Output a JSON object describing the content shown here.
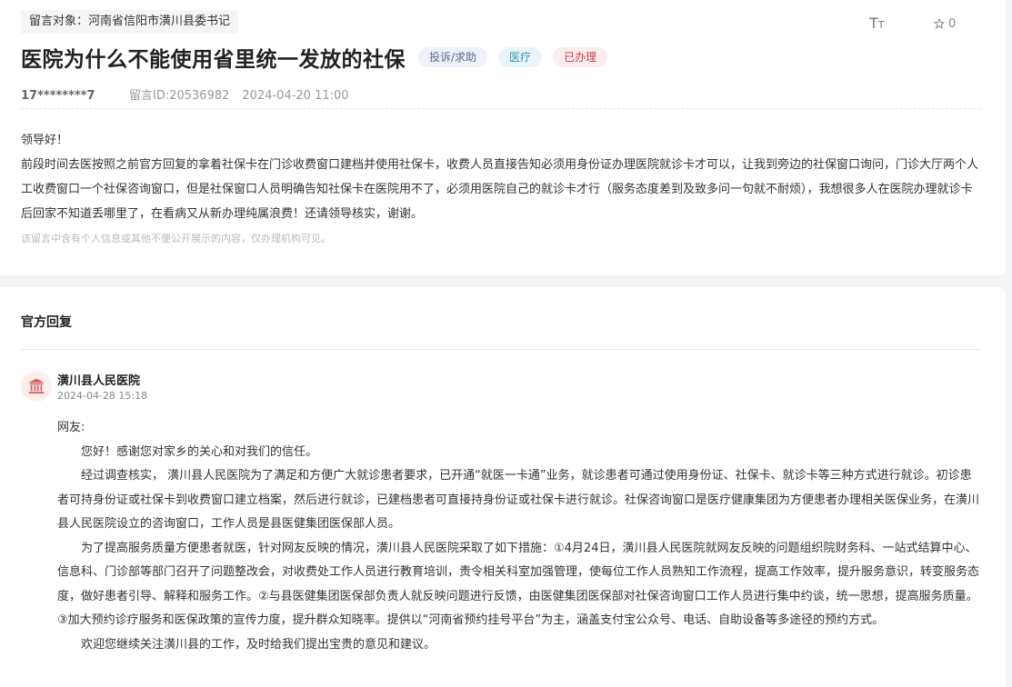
{
  "message": {
    "target_label": "留言对象：河南省信阳市潢川县委书记",
    "font_size_icon": "font-size-icon",
    "star_count": "0",
    "title": "医院为什么不能使用省里统一发放的社保",
    "tags": {
      "type": "投诉/求助",
      "category": "医疗",
      "status": "已办理"
    },
    "user": "17********7",
    "message_id": "留言ID:20536982",
    "timestamp": "2024-04-20 11:00",
    "greeting": "领导好！",
    "content": "前段时间去医按照之前官方回复的拿着社保卡在门诊收费窗口建档并使用社保卡，收费人员直接告知必须用身份证办理医院就诊卡才可以，让我到旁边的社保窗口询问，门诊大厅两个人工收费窗口一个社保咨询窗口，但是社保窗口人员明确告知社保卡在医院用不了，必须用医院自己的就诊卡才行（服务态度差到及致多问一句就不耐烦），我想很多人在医院办理就诊卡后回家不知道丢哪里了，在看病又从新办理纯属浪费！还请领导核实，谢谢。",
    "privacy_note": "该留言中含有个人信息或其他不便公开展示的内容，仅办理机构可见。"
  },
  "reply": {
    "heading": "官方回复",
    "org_icon": "government-building-icon",
    "org_name": "潢川县人民医院",
    "time": "2024-04-28 15:18",
    "salutation": "网友:",
    "paragraphs": [
      "您好！感谢您对家乡的关心和对我们的信任。",
      "经过调查核实， 潢川县人民医院为了满足和方便广大就诊患者要求，已开通“就医一卡通”业务，就诊患者可通过使用身份证、社保卡、就诊卡等三种方式进行就诊。初诊患者可持身份证或社保卡到收费窗口建立档案，然后进行就诊，已建档患者可直接持身份证或社保卡进行就诊。社保咨询窗口是医疗健康集团为方便患者办理相关医保业务，在潢川县人民医院设立的咨询窗口，工作人员是县医健集团医保部人员。",
      "为了提高服务质量方便患者就医，针对网友反映的情况，潢川县人民医院采取了如下措施：①4月24日，潢川县人民医院就网友反映的问题组织院财务科、一站式结算中心、信息科、门诊部等部门召开了问题整改会，对收费处工作人员进行教育培训，责令相关科室加强管理，使每位工作人员熟知工作流程，提高工作效率，提升服务意识，转变服务态度，做好患者引导、解释和服务工作。②与县医健集团医保部负责人就反映问题进行反馈，由医健集团医保部对社保咨询窗口工作人员进行集中约谈，统一思想，提高服务质量。③加大预约诊疗服务和医保政策的宣传力度，提升群众知晓率。提供以“河南省预约挂号平台”为主，涵盖支付宝公众号、电话、自助设备等多途径的预约方式。",
      "欢迎您继续关注潢川县的工作，及时给我们提出宝贵的意见和建议。"
    ]
  },
  "colors": {
    "status_pill_text": "#c0444b",
    "category_pill_text": "#3a8fb3",
    "type_pill_text": "#5a6a8a",
    "org_icon": "#d65a5a"
  }
}
